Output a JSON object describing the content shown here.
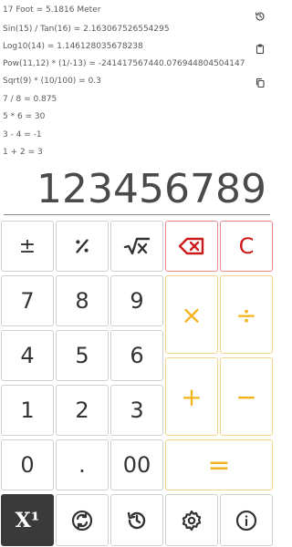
{
  "history": {
    "lines": [
      "17 Foot = 5.1816 Meter",
      "Sin(15) / Tan(16) = 2.163067526554295",
      "Log10(14) = 1.146128035678238",
      "Pow(11,12) * (1/-13) = -241417567440.076944804504147",
      "Sqrt(9) * (10/100) = 0.3",
      "7 / 8 = 0.875",
      "5 * 6 = 30",
      "3 - 4 = -1",
      "1 + 2 = 3"
    ]
  },
  "display": {
    "value": "123456789"
  },
  "keys": {
    "plus_minus": "±",
    "seven": "7",
    "eight": "8",
    "nine": "9",
    "four": "4",
    "five": "5",
    "six": "6",
    "one": "1",
    "two": "2",
    "three": "3",
    "zero": "0",
    "decimal": ".",
    "double_zero": "00",
    "clear": "C",
    "multiply": "×",
    "divide": "÷",
    "add": "+",
    "subtract": "−",
    "equals": "=",
    "power": "X¹"
  },
  "colors": {
    "red": "#cc1a1a",
    "orange": "#f2b31d",
    "dark_key": "#3a3a3a"
  },
  "icons": [
    "history-icon",
    "clipboard-icon",
    "copy-icon",
    "percent-icon",
    "sqrt-x-icon",
    "backspace-icon",
    "convert-icon",
    "history-button-icon",
    "settings-icon",
    "info-icon"
  ]
}
